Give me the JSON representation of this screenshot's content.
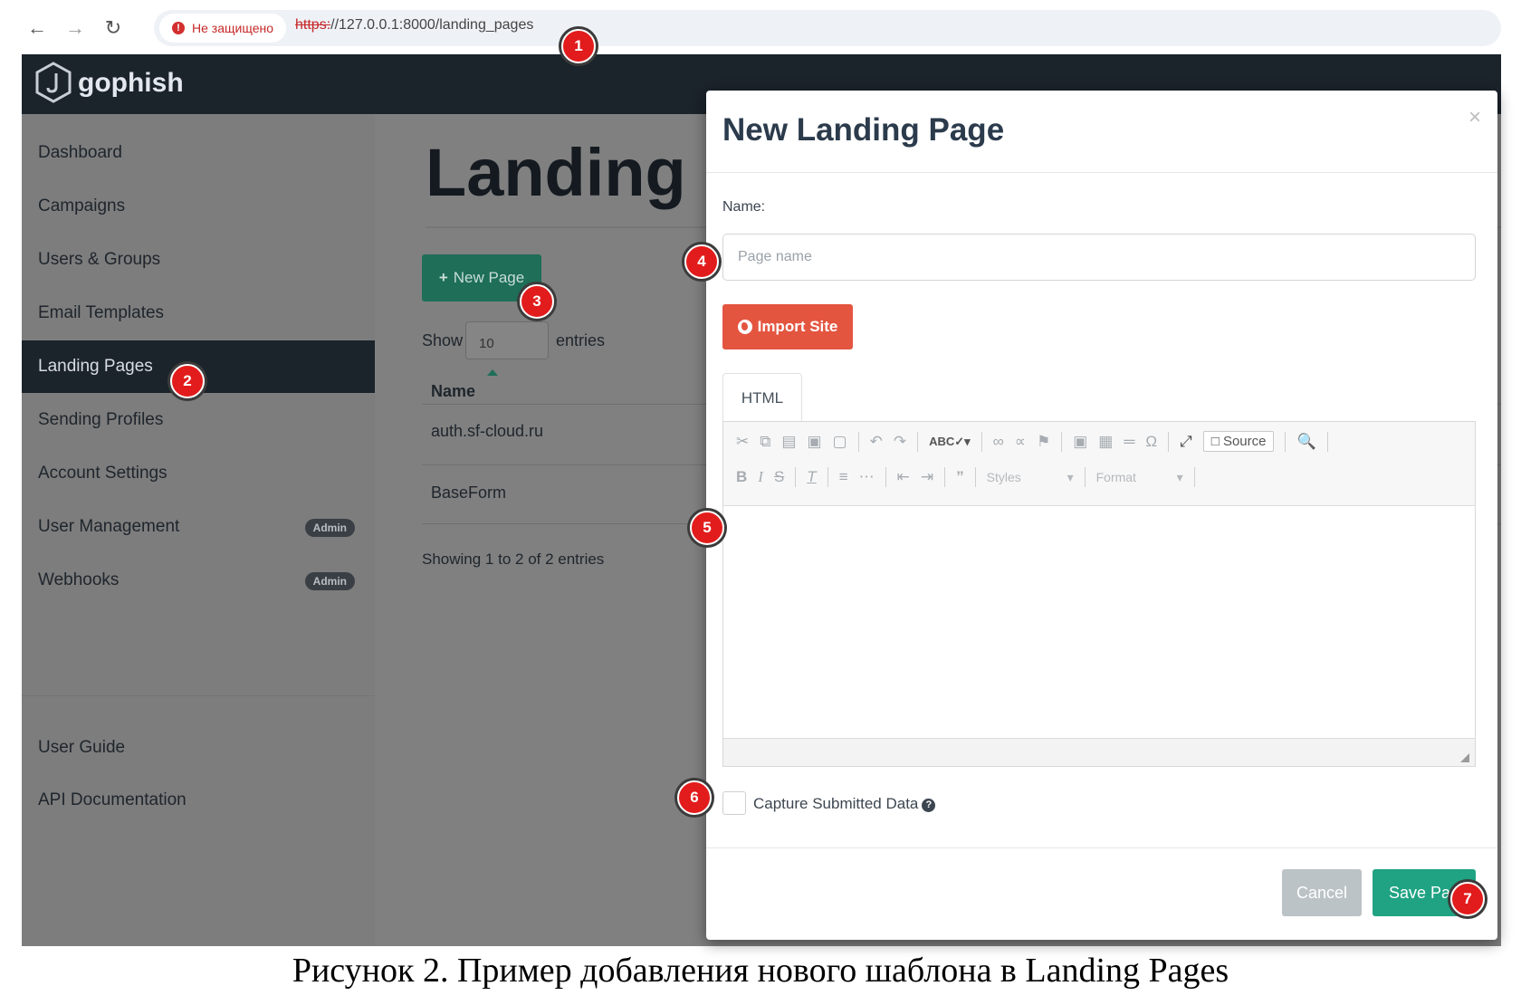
{
  "browser": {
    "security_label": "Не защищено",
    "url_scheme": "https:",
    "url_rest": "//127.0.0.1:8000/landing_pages"
  },
  "app": {
    "brand": "gophish",
    "sidebar": {
      "items": [
        {
          "label": "Dashboard"
        },
        {
          "label": "Campaigns"
        },
        {
          "label": "Users & Groups"
        },
        {
          "label": "Email Templates"
        },
        {
          "label": "Landing Pages",
          "active": true
        },
        {
          "label": "Sending Profiles"
        },
        {
          "label": "Account Settings"
        },
        {
          "label": "User Management",
          "badge": "Admin"
        },
        {
          "label": "Webhooks",
          "badge": "Admin"
        }
      ],
      "footer_items": [
        {
          "label": "User Guide"
        },
        {
          "label": "API Documentation"
        }
      ]
    },
    "main": {
      "title": "Landing P",
      "new_button": "New Page",
      "show_label": "Show",
      "page_size": "10",
      "entries_label": "entries",
      "column_name": "Name",
      "rows": [
        {
          "name": "auth.sf-cloud.ru"
        },
        {
          "name": "BaseForm"
        }
      ],
      "showing_text": "Showing 1 to 2 of 2 entries"
    }
  },
  "modal": {
    "title": "New Landing Page",
    "close": "×",
    "name_label": "Name:",
    "name_placeholder": "Page name",
    "import_button": "Import Site",
    "tab_label": "HTML",
    "toolbar": {
      "source_label": "Source",
      "styles_label": "Styles",
      "format_label": "Format"
    },
    "capture_label": "Capture Submitted Data",
    "cancel_button": "Cancel",
    "save_button": "Save Page"
  },
  "markers": [
    "1",
    "2",
    "3",
    "4",
    "5",
    "6",
    "7"
  ],
  "caption": "Рисунок 2. Пример добавления нового шаблона в Landing Pages",
  "colors": {
    "accent_green": "#20a383",
    "danger_red": "#e45540",
    "marker_red": "#e21c1c",
    "navbar_dark": "#1b232b"
  }
}
